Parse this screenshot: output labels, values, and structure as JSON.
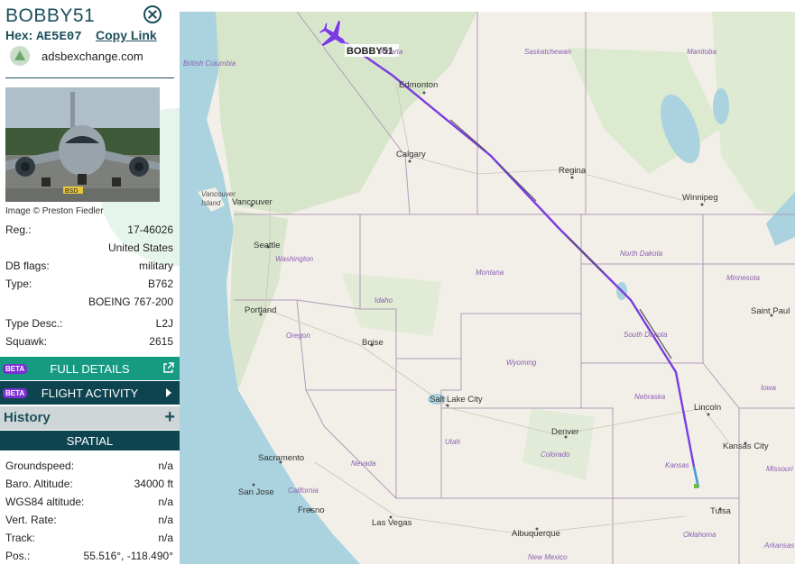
{
  "aircraft": {
    "callsign": "BOBBY51",
    "hex_label": "Hex:",
    "hex_value": "AE5E07",
    "copy_link": "Copy Link",
    "source": "adsbexchange.com",
    "image_credit": "Image © Preston Fiedler",
    "tail_number": "BSD"
  },
  "details": [
    {
      "label": "Reg.:",
      "value": "17-46026"
    },
    {
      "label": "",
      "value": "United States"
    },
    {
      "label": "DB flags:",
      "value": "military"
    },
    {
      "label": "Type:",
      "value": "B762"
    },
    {
      "label": "",
      "value": "BOEING 767-200"
    },
    {
      "label": "Type Desc.:",
      "value": "L2J"
    },
    {
      "label": "Squawk:",
      "value": "2615"
    }
  ],
  "buttons": {
    "beta": "BETA",
    "full_details": "FULL DETAILS",
    "flight_activity": "FLIGHT ACTIVITY"
  },
  "history": {
    "label": "History",
    "expand": "+"
  },
  "spatial": {
    "label": "SPATIAL",
    "rows": [
      {
        "label": "Groundspeed:",
        "value": "n/a"
      },
      {
        "label": "Baro. Altitude:",
        "value": "34000 ft"
      },
      {
        "label": "WGS84 altitude:",
        "value": "n/a"
      },
      {
        "label": "Vert. Rate:",
        "value": "n/a"
      },
      {
        "label": "Track:",
        "value": "n/a"
      },
      {
        "label": "Pos.:",
        "value": "55.516°, -118.490°"
      }
    ]
  },
  "map": {
    "plane_label": "BOBBY51",
    "cities": [
      "Edmonton",
      "Calgary",
      "Regina",
      "Winnipeg",
      "Vancouver",
      "Seattle",
      "Portland",
      "Boise",
      "Salt Lake City",
      "Denver",
      "Lincoln",
      "Kansas City",
      "Saint Paul",
      "Sacramento",
      "San Jose",
      "Fresno",
      "Las Vegas",
      "Albuquerque",
      "Tulsa"
    ],
    "islands": [
      "Vancouver",
      "Island"
    ],
    "regions": [
      "British Columbia",
      "Alberta",
      "Saskatchewan",
      "Manitoba",
      "Washington",
      "Montana",
      "North Dakota",
      "Minnesota",
      "Idaho",
      "Oregon",
      "South Dakota",
      "Wyoming",
      "Nebraska",
      "Iowa",
      "Nevada",
      "Utah",
      "Colorado",
      "Kansas",
      "Missouri",
      "California",
      "Oklahoma",
      "New Mexico",
      "Arkansas"
    ],
    "track_color": "#7a3de0"
  }
}
